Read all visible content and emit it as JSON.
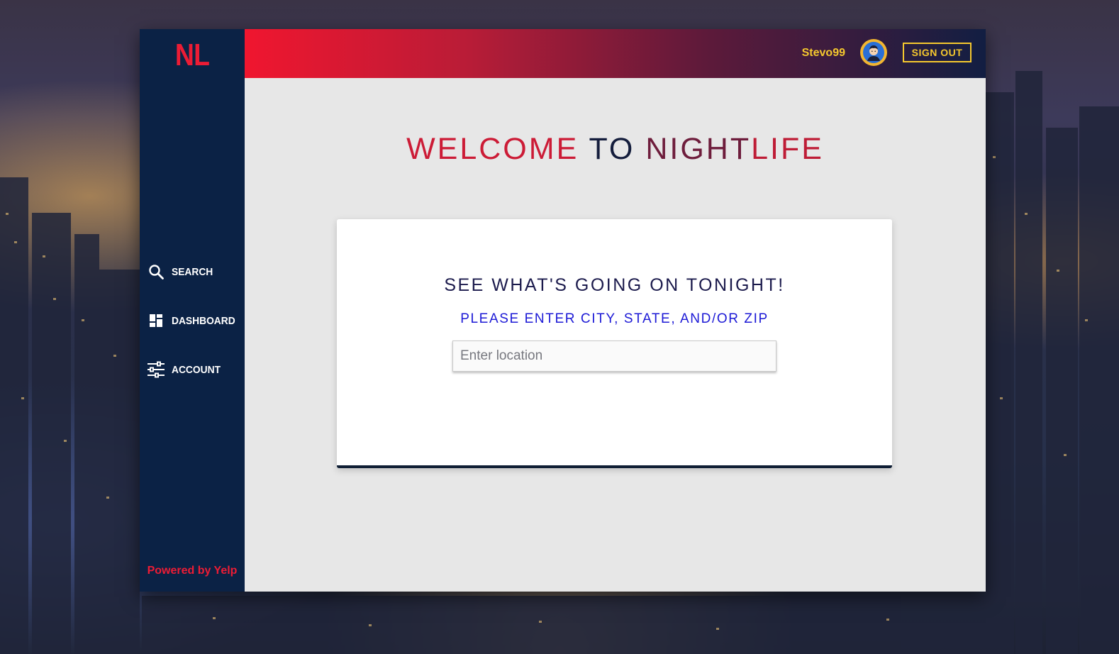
{
  "sidebar": {
    "logo": "NL",
    "items": [
      {
        "label": "SEARCH",
        "icon": "search-icon"
      },
      {
        "label": "DASHBOARD",
        "icon": "dashboard-icon"
      },
      {
        "label": "ACCOUNT",
        "icon": "sliders-icon"
      }
    ],
    "footer": "Powered by Yelp"
  },
  "header": {
    "username": "Stevo99",
    "avatar_icon": "avatar-icon",
    "signout_label": "SIGN OUT"
  },
  "main": {
    "welcome": {
      "part1": "WELCOME",
      "part2": "TO",
      "part3": "NIGHT",
      "part4": "LIFE"
    },
    "card": {
      "title": "SEE WHAT'S GOING ON TONIGHT!",
      "subtitle": "PLEASE ENTER CITY, STATE, AND/OR ZIP",
      "input_value": "",
      "input_placeholder": "Enter location"
    }
  },
  "colors": {
    "brand_red": "#ec1c35",
    "sidebar_navy": "#0b2245",
    "accent_yellow": "#f5c82e",
    "subtitle_blue": "#1c19d6"
  }
}
